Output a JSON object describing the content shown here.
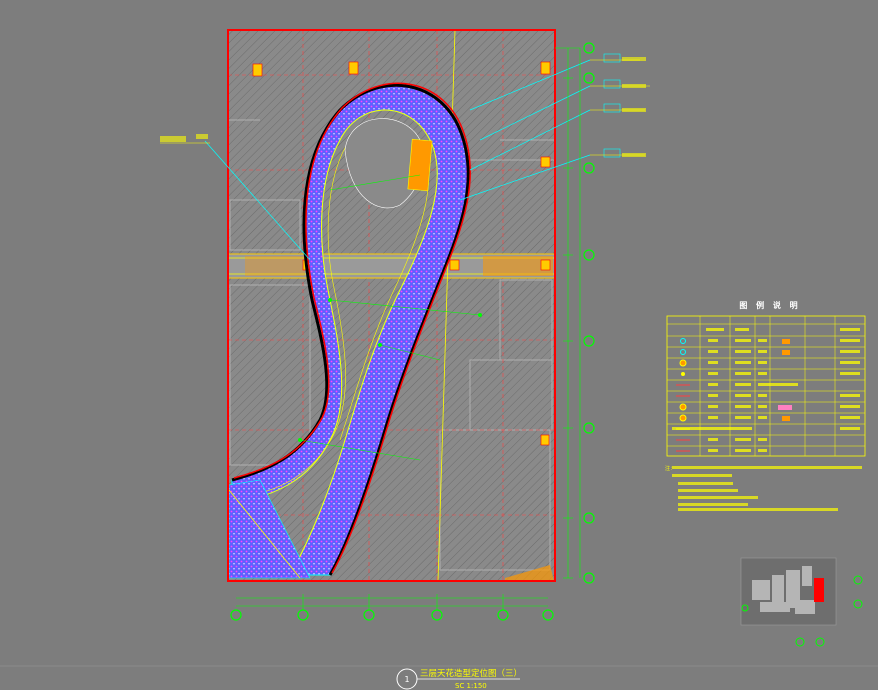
{
  "drawing": {
    "title": "三层天花造型定位图（三）",
    "scale": "SC 1:150",
    "sheet_number": "1"
  },
  "legend": {
    "title": "图 例 说 明",
    "rows": 11
  },
  "notes_label": "注：",
  "colors": {
    "background": "#7d7d7d",
    "frame": "#ff0000",
    "axis_green": "#00ff00",
    "callout_cyan": "#00ffff",
    "text_yellow": "#ffff00",
    "ribbon_blue": "#5050ff",
    "ribbon_magenta": "#ff00ff"
  }
}
